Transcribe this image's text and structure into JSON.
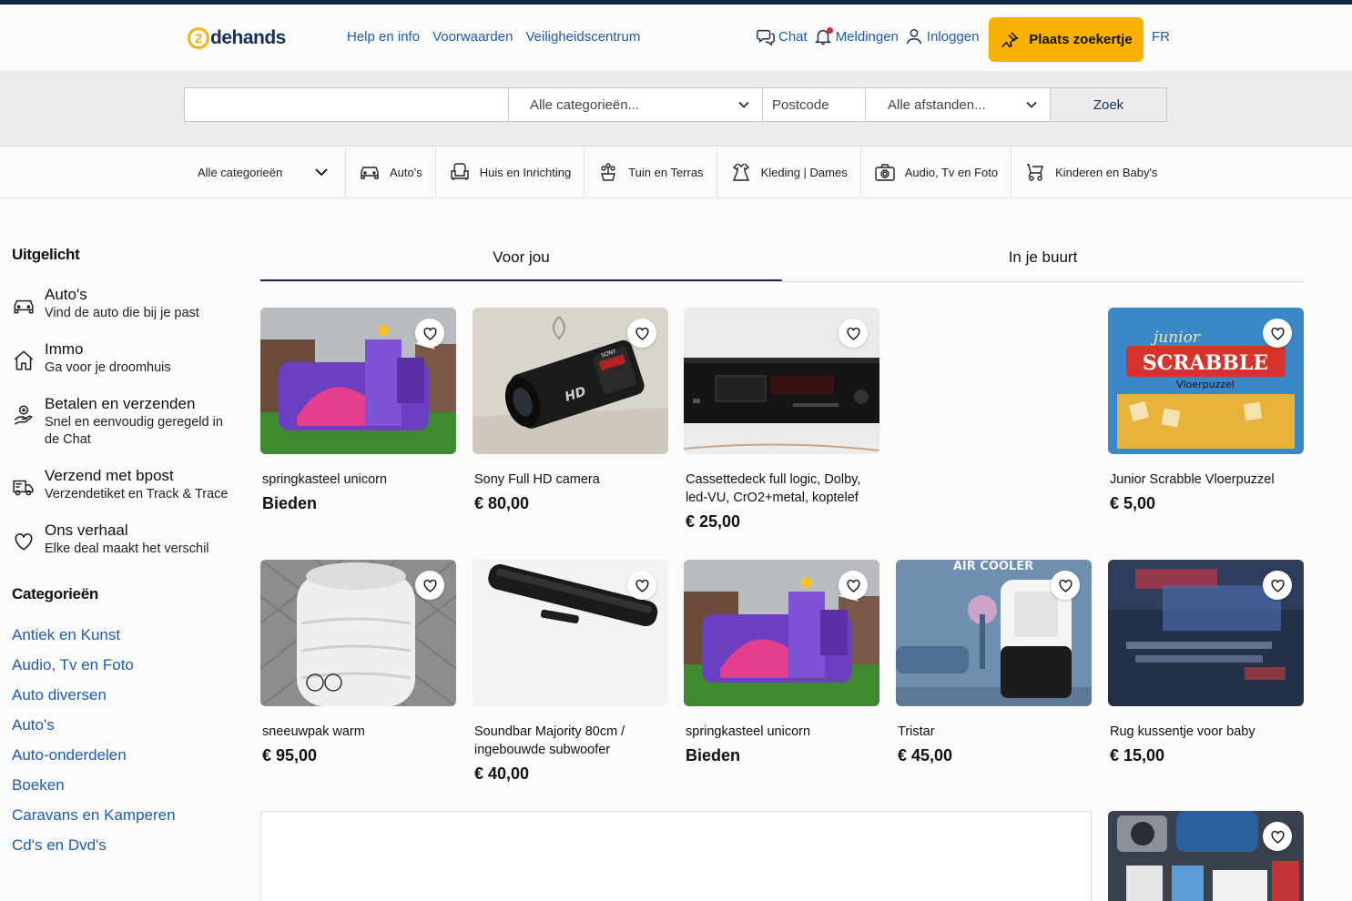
{
  "header": {
    "logo_number": "2",
    "logo_text": "dehands",
    "links": [
      "Help en info",
      "Voorwaarden",
      "Veiligheidscentrum"
    ],
    "chat": "Chat",
    "notifications": "Meldingen",
    "login": "Inloggen",
    "place_ad": "Plaats zoekertje",
    "language": "FR"
  },
  "search": {
    "query_value": "",
    "category": "Alle categorieën...",
    "postcode_placeholder": "Postcode",
    "distance": "Alle afstanden...",
    "button": "Zoek"
  },
  "catbar": {
    "all": "Alle categorieën",
    "items": [
      "Auto's",
      "Huis en Inrichting",
      "Tuin en Terras",
      "Kleding | Dames",
      "Audio, Tv en Foto",
      "Kinderen en Baby's"
    ]
  },
  "sidebar": {
    "featured_title": "Uitgelicht",
    "featured": [
      {
        "title": "Auto's",
        "sub": "Vind de auto die bij je past",
        "icon": "car-icon"
      },
      {
        "title": "Immo",
        "sub": "Ga voor je droomhuis",
        "icon": "house-icon"
      },
      {
        "title": "Betalen en verzenden",
        "sub": "Snel en eenvoudig geregeld in de Chat",
        "icon": "payment-icon"
      },
      {
        "title": "Verzend met bpost",
        "sub": "Verzendetiket en Track & Trace",
        "icon": "truck-icon"
      },
      {
        "title": "Ons verhaal",
        "sub": "Elke deal maakt het verschil",
        "icon": "heart-icon"
      }
    ],
    "categories_title": "Categorieën",
    "categories": [
      "Antiek en Kunst",
      "Audio, Tv en Foto",
      "Auto diversen",
      "Auto's",
      "Auto-onderdelen",
      "Boeken",
      "Caravans en Kamperen",
      "Cd's en Dvd's"
    ]
  },
  "tabs": [
    "Voor jou",
    "In je buurt"
  ],
  "listings": [
    {
      "title": "springkasteel unicorn",
      "price": "Bieden"
    },
    {
      "title": "Sony Full HD camera",
      "price": "€ 80,00"
    },
    {
      "title": "Cassettedeck full logic, Dolby, led-VU, CrO2+metal, koptelef",
      "price": "€ 25,00"
    },
    {
      "title": "Junior Scrabble Vloerpuzzel",
      "price": "€ 5,00"
    },
    {
      "title": "sneeuwpak warm",
      "price": "€ 95,00"
    },
    {
      "title": "Soundbar Majority 80cm / ingebouwde subwoofer",
      "price": "€ 40,00"
    },
    {
      "title": "springkasteel unicorn",
      "price": "Bieden"
    },
    {
      "title": "Tristar",
      "price": "€ 45,00"
    },
    {
      "title": "Rug kussentje voor baby",
      "price": "€ 15,00"
    }
  ],
  "image_text": {
    "scrabble_brand": "junior",
    "scrabble_name": "SCRABBLE",
    "scrabble_sub": "Vloerpuzzel",
    "camera_brand": "SONY",
    "camera_hd": "HD",
    "cooler_text": "AIR COOLER"
  },
  "colors": {
    "brand_navy": "#10284a",
    "accent": "#f8b100",
    "link": "#1f5ab4"
  }
}
